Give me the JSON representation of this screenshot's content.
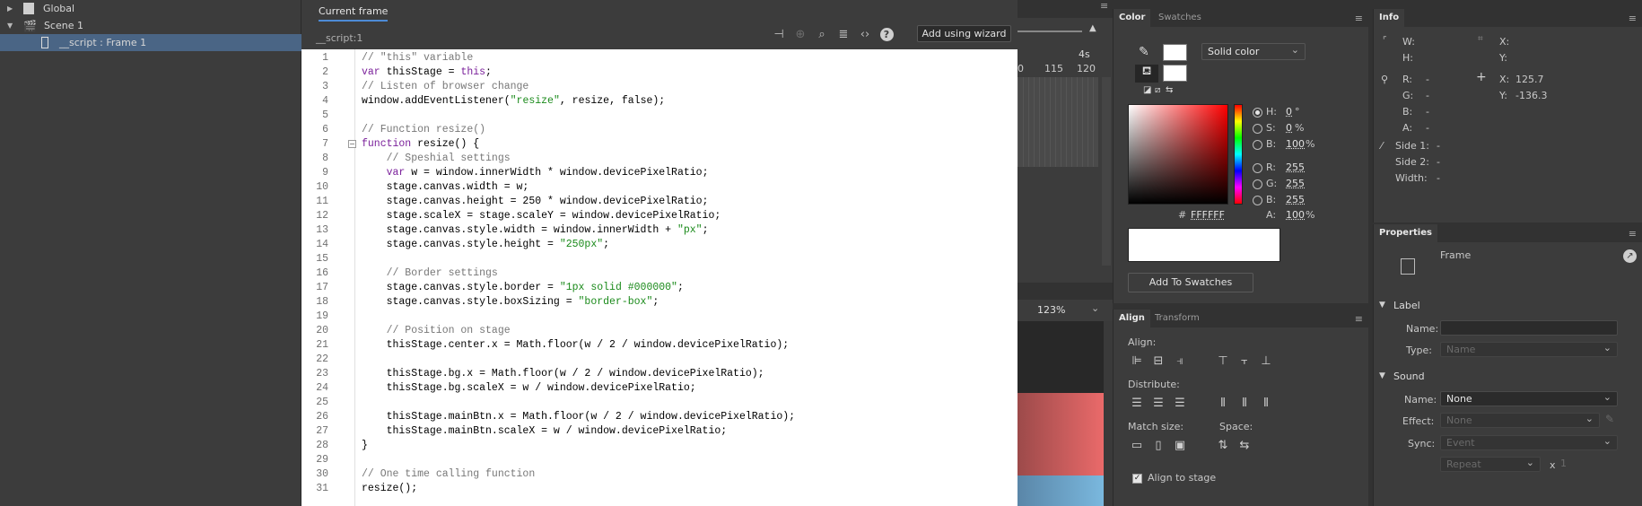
{
  "navigator": {
    "items": [
      {
        "label": "Global",
        "icon": "document-icon"
      },
      {
        "label": "Scene 1",
        "icon": "clapper-icon"
      },
      {
        "label": "__script : Frame 1",
        "icon": "frame-icon"
      }
    ]
  },
  "actions": {
    "tab": "Current frame",
    "script_path": "__script:1",
    "wizard_label": "Add using wizard",
    "code_lines": [
      {
        "n": "1",
        "t": "// \"this\" variable",
        "c": "cm",
        "indent": 0
      },
      {
        "n": "2",
        "t": "var thisStage = this;",
        "c": "",
        "indent": 0
      },
      {
        "n": "3",
        "t": "// Listen of browser change",
        "c": "cm",
        "indent": 0
      },
      {
        "n": "4",
        "t": "window.addEventListener(\"resize\", resize, false);",
        "c": "",
        "indent": 0
      },
      {
        "n": "5",
        "t": "",
        "c": "",
        "indent": 0
      },
      {
        "n": "6",
        "t": "// Function resize()",
        "c": "cm",
        "indent": 0
      },
      {
        "n": "7",
        "t": "function resize() {",
        "c": "",
        "indent": 0
      },
      {
        "n": "8",
        "t": "// Speshial settings",
        "c": "cm",
        "indent": 1
      },
      {
        "n": "9",
        "t": "var w = window.innerWidth * window.devicePixelRatio;",
        "c": "",
        "indent": 1
      },
      {
        "n": "10",
        "t": "stage.canvas.width = w;",
        "c": "",
        "indent": 1
      },
      {
        "n": "11",
        "t": "stage.canvas.height = 250 * window.devicePixelRatio;",
        "c": "",
        "indent": 1
      },
      {
        "n": "12",
        "t": "stage.scaleX = stage.scaleY = window.devicePixelRatio;",
        "c": "",
        "indent": 1
      },
      {
        "n": "13",
        "t": "stage.canvas.style.width = window.innerWidth + \"px\";",
        "c": "",
        "indent": 1
      },
      {
        "n": "14",
        "t": "stage.canvas.style.height = \"250px\";",
        "c": "",
        "indent": 1
      },
      {
        "n": "15",
        "t": "",
        "c": "",
        "indent": 0
      },
      {
        "n": "16",
        "t": "// Border settings",
        "c": "cm",
        "indent": 1
      },
      {
        "n": "17",
        "t": "stage.canvas.style.border = \"1px solid #000000\";",
        "c": "",
        "indent": 1
      },
      {
        "n": "18",
        "t": "stage.canvas.style.boxSizing = \"border-box\";",
        "c": "",
        "indent": 1
      },
      {
        "n": "19",
        "t": "",
        "c": "",
        "indent": 0
      },
      {
        "n": "20",
        "t": "// Position on stage",
        "c": "cm",
        "indent": 1
      },
      {
        "n": "21",
        "t": "thisStage.center.x = Math.floor(w / 2 / window.devicePixelRatio);",
        "c": "",
        "indent": 1
      },
      {
        "n": "22",
        "t": "",
        "c": "",
        "indent": 0
      },
      {
        "n": "23",
        "t": "thisStage.bg.x = Math.floor(w / 2 / window.devicePixelRatio);",
        "c": "",
        "indent": 1
      },
      {
        "n": "24",
        "t": "thisStage.bg.scaleX = w / window.devicePixelRatio;",
        "c": "",
        "indent": 1
      },
      {
        "n": "25",
        "t": "",
        "c": "",
        "indent": 0
      },
      {
        "n": "26",
        "t": "thisStage.mainBtn.x = Math.floor(w / 2 / window.devicePixelRatio);",
        "c": "",
        "indent": 1
      },
      {
        "n": "27",
        "t": "thisStage.mainBtn.scaleX = w / window.devicePixelRatio;",
        "c": "",
        "indent": 1
      },
      {
        "n": "28",
        "t": "}",
        "c": "",
        "indent": 0
      },
      {
        "n": "29",
        "t": "",
        "c": "",
        "indent": 0
      },
      {
        "n": "30",
        "t": "// One time calling function",
        "c": "cm",
        "indent": 0
      },
      {
        "n": "31",
        "t": "resize();",
        "c": "",
        "indent": 0
      }
    ]
  },
  "timeline": {
    "marker": "4s",
    "frames": [
      "0",
      "115",
      "120"
    ],
    "zoom": "123%"
  },
  "color": {
    "tabs": [
      "Color",
      "Swatches"
    ],
    "fill_type": "Solid color",
    "h": "0",
    "h_unit": "°",
    "s": "0",
    "s_unit": "%",
    "b": "100",
    "b_unit": "%",
    "r": "255",
    "g": "255",
    "bl": "255",
    "hex_prefix": "#",
    "hex": "FFFFFF",
    "a": "100",
    "a_unit": "%",
    "labels": {
      "h": "H:",
      "s": "S:",
      "b": "B:",
      "r": "R:",
      "g": "G:",
      "bl": "B:",
      "a": "A:"
    },
    "add_swatches": "Add To Swatches"
  },
  "align": {
    "tabs": [
      "Align",
      "Transform"
    ],
    "align_label": "Align:",
    "distribute_label": "Distribute:",
    "match_size_label": "Match size:",
    "space_label": "Space:",
    "align_to_stage": "Align to stage"
  },
  "info": {
    "tab": "Info",
    "w_label": "W:",
    "h_label": "H:",
    "x_label": "X:",
    "y_label": "Y:",
    "r_label": "R:",
    "g_label": "G:",
    "b_label": "B:",
    "a_label": "A:",
    "r": "-",
    "g": "-",
    "b": "-",
    "a": "-",
    "cursor_x": "125.7",
    "cursor_y": "-136.3",
    "side1_label": "Side 1:",
    "side2_label": "Side 2:",
    "width_label": "Width:",
    "side1": "-",
    "side2": "-",
    "width": "-"
  },
  "properties": {
    "tab": "Properties",
    "type": "Frame",
    "label_section": "Label",
    "name_label": "Name:",
    "type_label": "Type:",
    "type_value": "Name",
    "sound_section": "Sound",
    "sound_name_label": "Name:",
    "sound_name_value": "None",
    "effect_label": "Effect:",
    "effect_value": "None",
    "sync_label": "Sync:",
    "sync_value": "Event",
    "repeat_value": "Repeat",
    "repeat_x": "x",
    "repeat_count": "1"
  }
}
